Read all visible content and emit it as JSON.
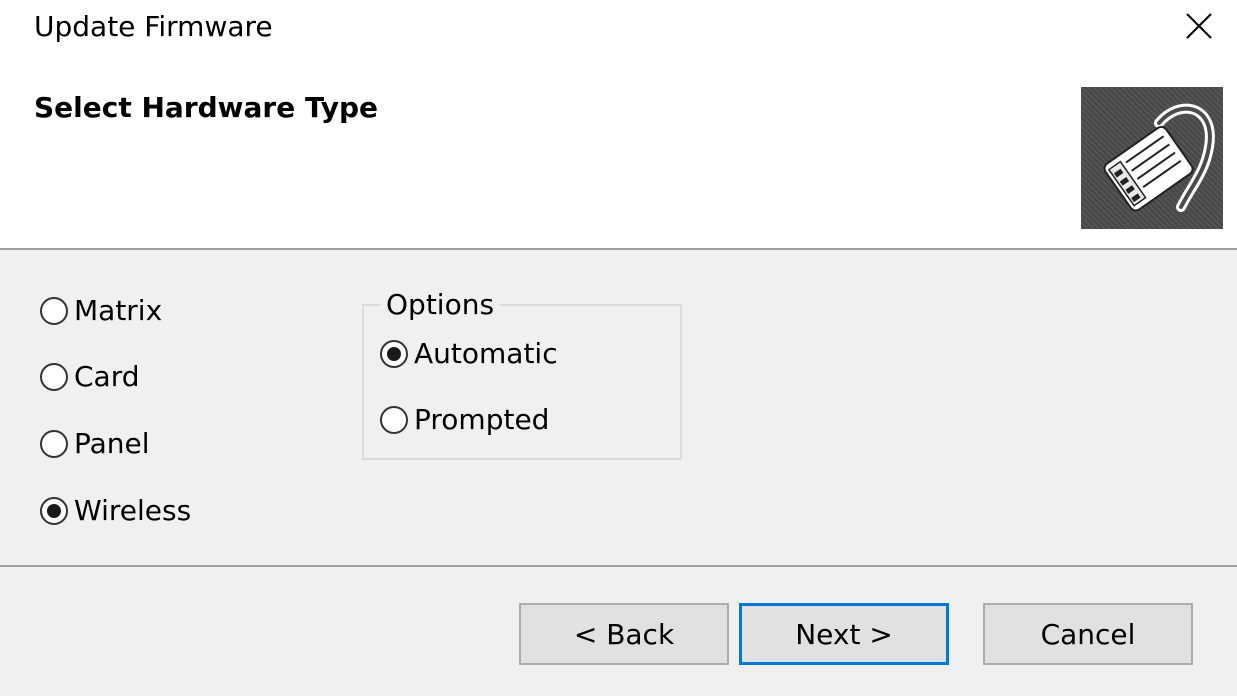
{
  "window": {
    "title": "Update Firmware",
    "close_icon": "close-icon"
  },
  "header": {
    "page_title": "Select Hardware Type",
    "image_icon": "network-cable-icon"
  },
  "hardware_types": [
    {
      "label": "Matrix",
      "checked": false
    },
    {
      "label": "Card",
      "checked": false
    },
    {
      "label": "Panel",
      "checked": false
    },
    {
      "label": "Wireless",
      "checked": true
    }
  ],
  "options": {
    "legend": "Options",
    "items": [
      {
        "label": "Automatic",
        "checked": true
      },
      {
        "label": "Prompted",
        "checked": false
      }
    ]
  },
  "buttons": {
    "back": "< Back",
    "next": "Next >",
    "cancel": "Cancel"
  },
  "colors": {
    "header_bg": "#ffffff",
    "body_bg": "#f0f0f0",
    "default_button_border": "#0078d7"
  }
}
